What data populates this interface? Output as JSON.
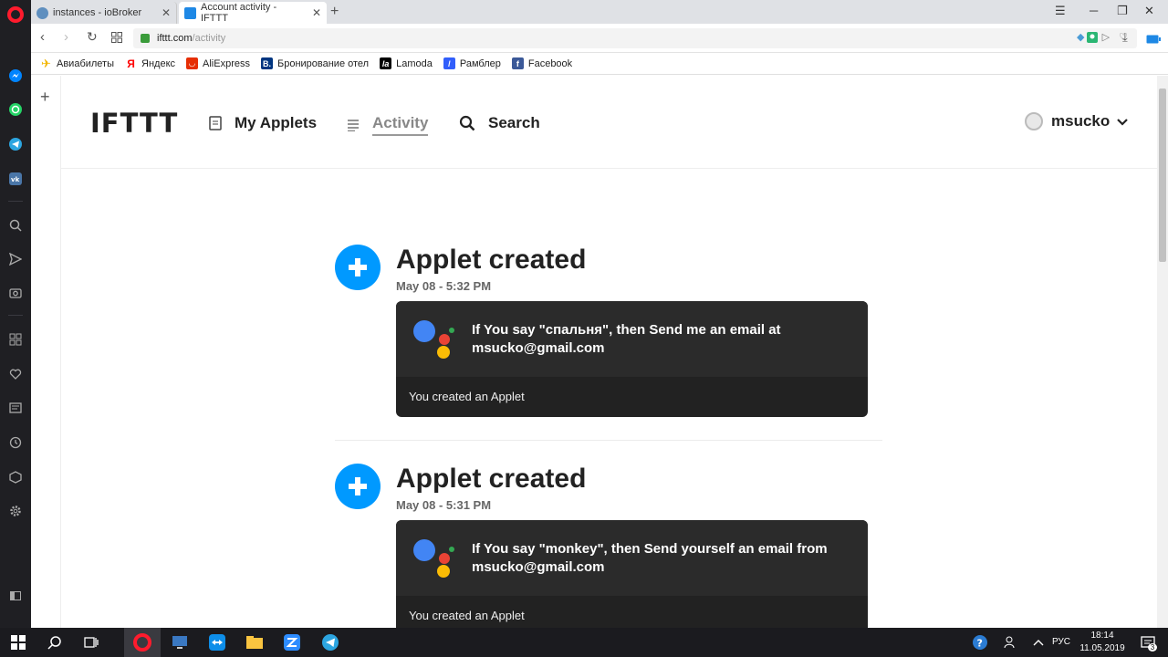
{
  "browser": {
    "tabs": [
      {
        "title": "instances - ioBroker",
        "active": false
      },
      {
        "title": "Account activity - IFTTT",
        "active": true
      }
    ],
    "address": {
      "host": "ifttt.com",
      "path": "/activity",
      "badge_count": "4"
    },
    "bookmarks": [
      {
        "label": "Авиабилеты",
        "icon": "plane-icon",
        "color": "#f2b600"
      },
      {
        "label": "Яндекс",
        "icon": "yandex-icon",
        "color": "#ff0000"
      },
      {
        "label": "AliExpress",
        "icon": "aliexpress-icon",
        "color": "#e62e04"
      },
      {
        "label": "Бронирование отел",
        "icon": "booking-icon",
        "color": "#003580"
      },
      {
        "label": "Lamoda",
        "icon": "lamoda-icon",
        "color": "#000000"
      },
      {
        "label": "Рамблер",
        "icon": "rambler-icon",
        "color": "#315efb"
      },
      {
        "label": "Facebook",
        "icon": "facebook-icon",
        "color": "#3b5998"
      }
    ]
  },
  "header": {
    "logo": "IFTTT",
    "nav": {
      "my_applets": "My Applets",
      "activity": "Activity",
      "search": "Search"
    },
    "user": "msucko"
  },
  "entries": [
    {
      "title": "Applet created",
      "date": "May 08 - 5:32 PM",
      "text": "If You say \"спальня\", then Send me an email at msucko@gmail.com",
      "footer": "You created an Applet"
    },
    {
      "title": "Applet created",
      "date": "May 08 - 5:31 PM",
      "text": "If You say \"monkey\", then Send yourself an email from msucko@gmail.com",
      "footer": "You created an Applet"
    }
  ],
  "taskbar": {
    "lang": "РУС",
    "time": "18:14",
    "date": "11.05.2019",
    "notifications": "3"
  },
  "colors": {
    "accent": "#0099ff",
    "card_bg": "#222222",
    "google_blue": "#4285f4",
    "google_red": "#ea4335",
    "google_yellow": "#fbbc05",
    "google_green": "#34a853"
  }
}
